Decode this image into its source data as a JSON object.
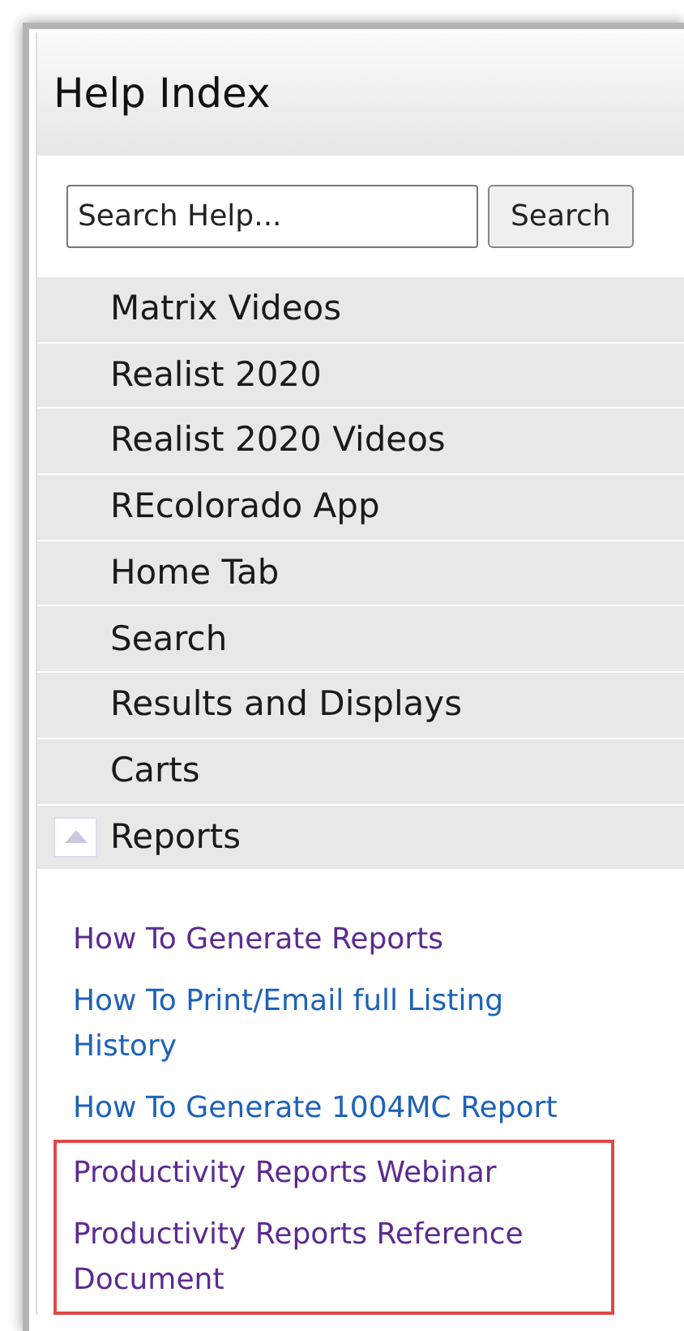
{
  "panel": {
    "title": "Help Index"
  },
  "search": {
    "placeholder": "Search Help...",
    "button": "Search"
  },
  "categories": [
    {
      "label": "Matrix Videos",
      "expanded": false
    },
    {
      "label": "Realist 2020",
      "expanded": false
    },
    {
      "label": "Realist 2020 Videos",
      "expanded": false
    },
    {
      "label": "REcolorado App",
      "expanded": false
    },
    {
      "label": "Home Tab",
      "expanded": false
    },
    {
      "label": "Search",
      "expanded": false
    },
    {
      "label": "Results and Displays",
      "expanded": false
    },
    {
      "label": "Carts",
      "expanded": false
    },
    {
      "label": "Reports",
      "expanded": true,
      "links": [
        {
          "label": "How To Generate Reports",
          "visited": true,
          "highlighted": false
        },
        {
          "label": "How To Print/Email full Listing History",
          "visited": false,
          "highlighted": false
        },
        {
          "label": "How To Generate 1004MC Report",
          "visited": false,
          "highlighted": false
        },
        {
          "label": "Productivity Reports Webinar",
          "visited": true,
          "highlighted": true
        },
        {
          "label": "Productivity Reports Reference Document",
          "visited": true,
          "highlighted": true
        }
      ]
    }
  ]
}
